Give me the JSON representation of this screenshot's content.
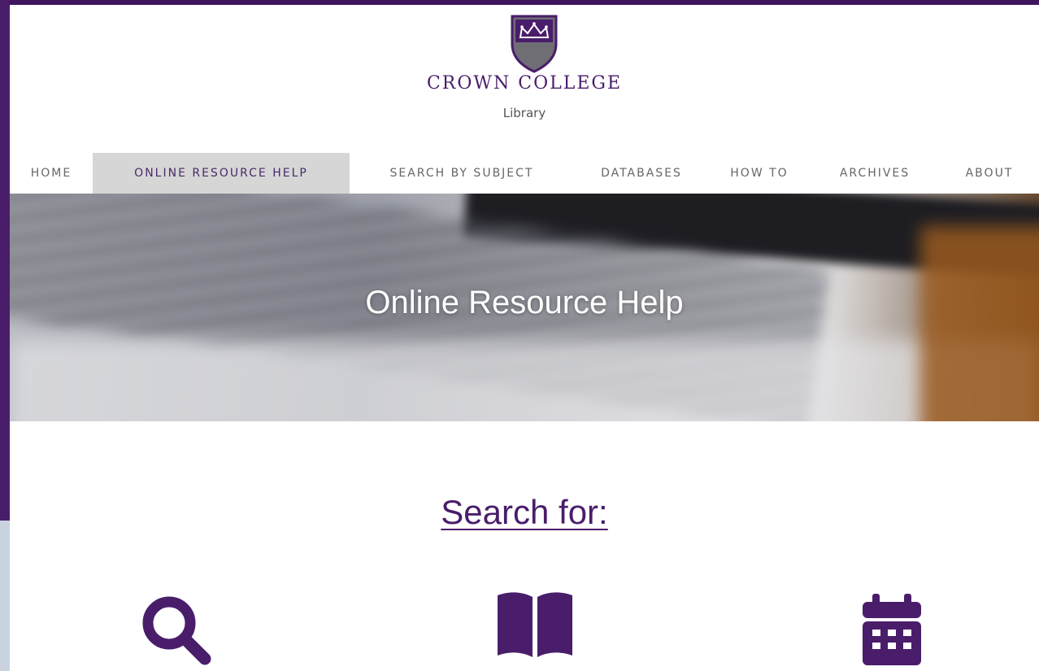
{
  "brand": {
    "name": "CROWN COLLEGE",
    "subtitle": "Library"
  },
  "nav": {
    "items": [
      {
        "label": "HOME",
        "active": false
      },
      {
        "label": "ONLINE RESOURCE HELP",
        "active": true
      },
      {
        "label": "SEARCH BY SUBJECT",
        "active": false
      },
      {
        "label": "DATABASES",
        "active": false
      },
      {
        "label": "HOW TO",
        "active": false
      },
      {
        "label": "ARCHIVES",
        "active": false
      },
      {
        "label": "ABOUT",
        "active": false
      }
    ]
  },
  "hero": {
    "title": "Online Resource Help"
  },
  "search_section": {
    "heading": "Search for:",
    "icons": [
      "search-icon",
      "book-icon",
      "calendar-icon"
    ]
  },
  "colors": {
    "brand_purple": "#4a1d6b",
    "nav_active_bg": "#d6d6d6",
    "nav_text": "#666666"
  }
}
